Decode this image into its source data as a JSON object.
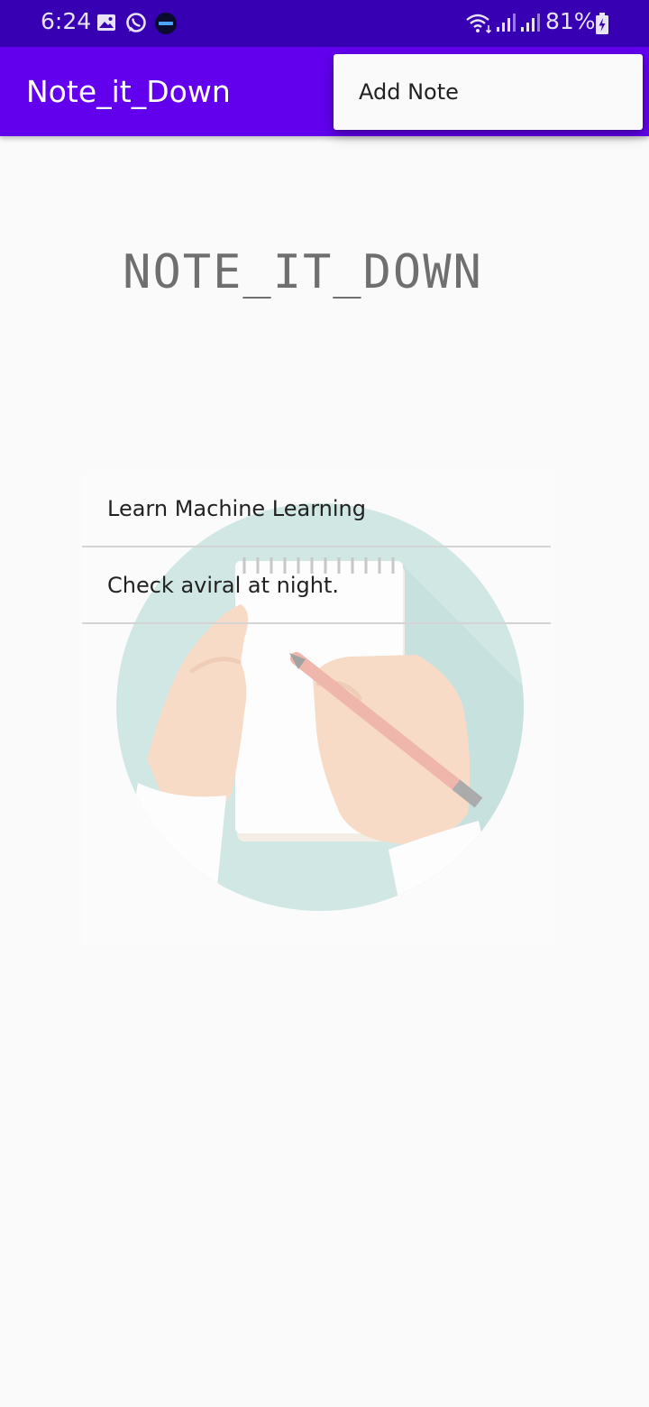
{
  "status_bar": {
    "time": "6:24",
    "battery": "81%",
    "icons": [
      "gallery-icon",
      "whatsapp-icon",
      "app-notification-icon",
      "wifi-icon",
      "signal-icon",
      "signal-icon",
      "battery-charging-icon"
    ]
  },
  "app_bar": {
    "title": "Note_it_Down"
  },
  "overflow_menu": {
    "items": [
      {
        "label": "Add Note"
      }
    ]
  },
  "main": {
    "heading": "NOTE_IT_DOWN",
    "notes": [
      {
        "text": "Learn Machine Learning"
      },
      {
        "text": "Check aviral at night."
      }
    ]
  },
  "colors": {
    "status_bar": "#3700b3",
    "app_bar": "#6200ee",
    "background": "#fafafa"
  }
}
